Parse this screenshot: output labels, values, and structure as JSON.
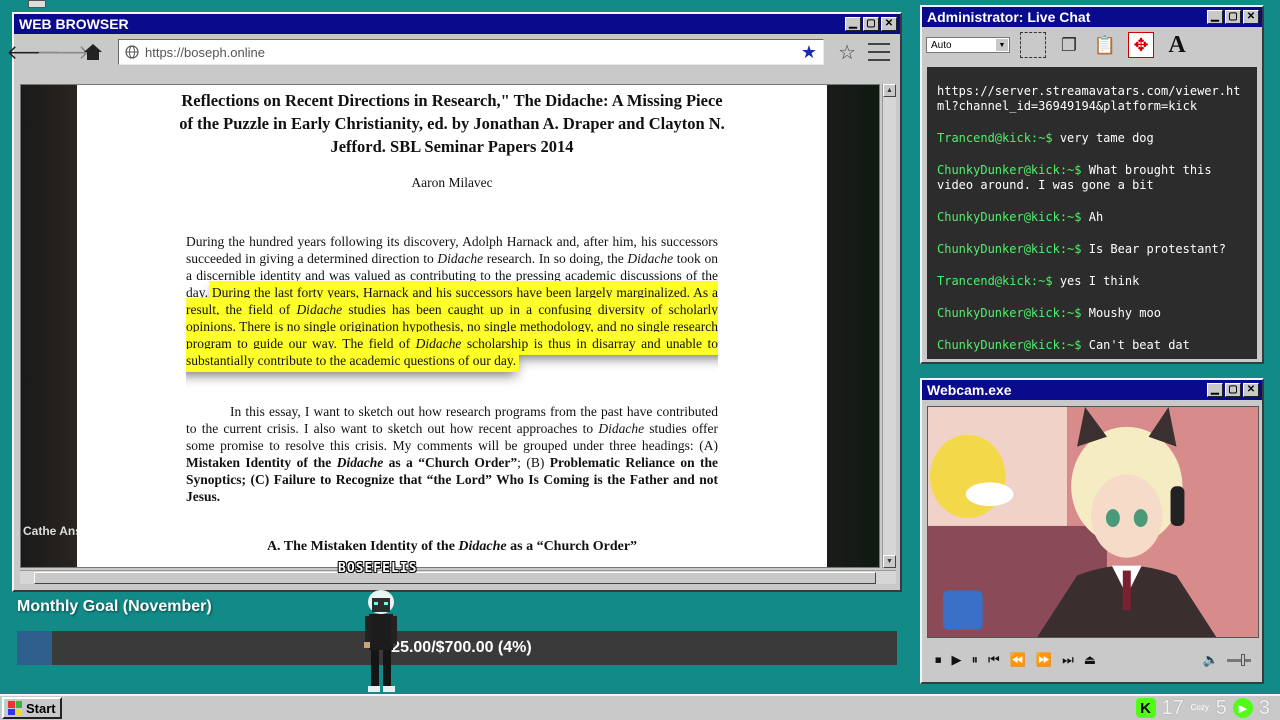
{
  "browser": {
    "title": "WEB BROWSER",
    "url": "https://boseph.online",
    "controls": {
      "minimize": "▁",
      "maximize": "▢",
      "close": "✕"
    }
  },
  "document": {
    "title": "Reflections on Recent Directions in Research,\" The Didache: A Missing Piece of the Puzzle in Early Christianity, ed. by Jonathan A. Draper and Clayton N. Jefford.  SBL Seminar Papers 2014",
    "author": "Aaron Milavec",
    "para1_intro": "During the hundred years following its discovery, Adolph Harnack and, after him, his successors succeeded in giving a determined direction to ",
    "didache": "Didache",
    "para1_mid": " research.  In so doing, the ",
    "para1_end": " took on a discernible identity and was valued as contributing to the pressing academic discussions of the day. ",
    "highlight_a": "During the last forty years, Harnack and his successors have been largely marginalized.  As a result, the field of ",
    "highlight_b": " studies has been caught up in a confusing diversity of scholarly opinions.  There is no single origination hypothesis, no single methodology, and no single research program to guide our way.  The field of ",
    "highlight_c": " scholarship is thus in disarray and unable to substantially contribute to the academic questions of our day.",
    "para2_a": "In this essay, I want to sketch out how research programs from the past have contributed to the current crisis.  I also want to sketch out how recent approaches to ",
    "para2_b": "  studies offer some promise to resolve this crisis.  My comments will be grouped under three headings: (A) ",
    "para2_headA1": "Mistaken Identity of the ",
    "para2_headA2": " as a “Church Order”",
    "para2_c": "; (B) ",
    "para2_headB": "Problematic Reliance on the Synoptics; (C) Failure to Recognize that “the Lord” Who Is Coming is the Father and not Jesus.",
    "section_a1": "A. The Mistaken Identity of the ",
    "section_a2": " as a “Church Order”",
    "left_logo": "Cathe Answ"
  },
  "overlay": {
    "username_tag": "BOSEFELIS",
    "goal_title": "Monthly Goal (November)",
    "goal_text": "$25.00/$700.00 (4%)",
    "goal_fraction": 0.04
  },
  "chat": {
    "title": "Administrator: Live Chat",
    "dropdown": "Auto",
    "top_line": "https://server.streamavatars.com/viewer.html?channel_id=36949194&platform=kick",
    "messages": [
      {
        "user": "Trancend@kick:~$",
        "text": "very tame dog"
      },
      {
        "user": "ChunkyDunker@kick:~$",
        "text": "What brought this video around. I was gone a bit"
      },
      {
        "user": "ChunkyDunker@kick:~$",
        "text": "Ah"
      },
      {
        "user": "ChunkyDunker@kick:~$",
        "text": "Is Bear protestant?"
      },
      {
        "user": "Trancend@kick:~$",
        "text": "yes I think"
      },
      {
        "user": "ChunkyDunker@kick:~$",
        "text": "Moushy moo"
      },
      {
        "user": "ChunkyDunker@kick:~$",
        "text": "Can't beat dat"
      }
    ]
  },
  "webcam": {
    "title": "Webcam.exe"
  },
  "taskbar": {
    "start_label": "Start",
    "tray_num1": "17",
    "tray_cozy": "Cozy",
    "tray_num2": "5",
    "tray_num3": "3"
  },
  "colors": {
    "desktop": "#128a88",
    "titlebar": "#0a0a8c",
    "highlight": "#ffff2a",
    "chat_user": "#4ef06a",
    "kick_green": "#53fc18"
  }
}
